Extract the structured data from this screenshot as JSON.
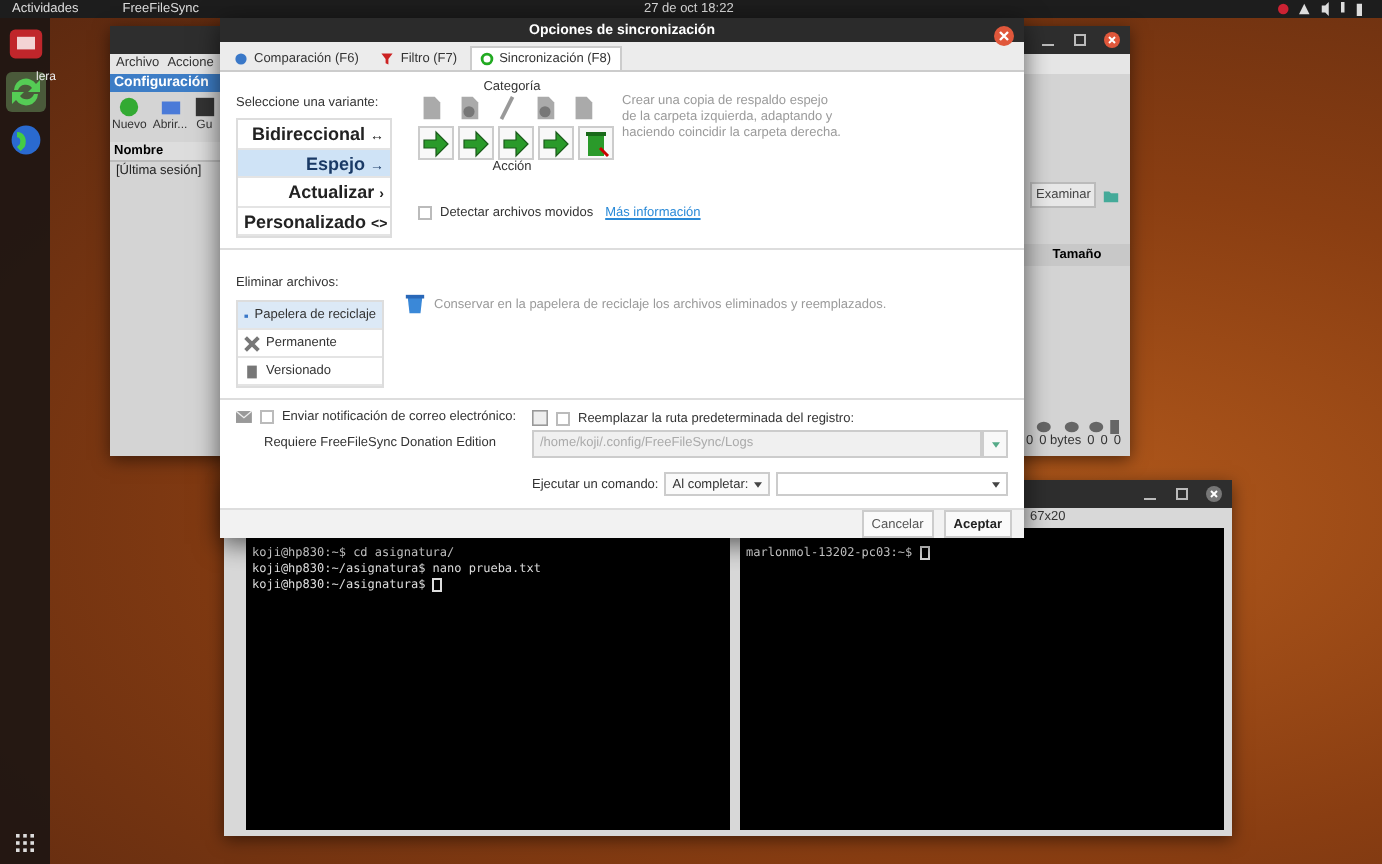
{
  "top_bar": {
    "activities": "Actividades",
    "app_menu": "FreeFileSync",
    "clock": "27 de oct  18:22"
  },
  "dock": {
    "label": "lera"
  },
  "main_window": {
    "menu": [
      "Archivo",
      "Accione"
    ],
    "panel_title": "Configuración",
    "toolbar": [
      "Nuevo",
      "Abrir...",
      "Gu"
    ],
    "column": "Nombre",
    "session": "[Última sesión]",
    "browse_button": "Examinar",
    "size_column": "Tamaño",
    "status": [
      "0",
      "0 bytes",
      "0",
      "0",
      "0"
    ]
  },
  "terminal": {
    "title": "67x20",
    "left_lines": [
      "koji@hp830:~$ cd asignatura/",
      "koji@hp830:~/asignatura$ nano prueba.txt",
      "koji@hp830:~/asignatura$ "
    ],
    "right_lines": [
      "marlonmol-13202-pc03:~$ "
    ]
  },
  "dialog": {
    "title": "Opciones de sincronización",
    "tabs": [
      {
        "label": "Comparación (F6)",
        "selected": false
      },
      {
        "label": "Filtro (F7)",
        "selected": false
      },
      {
        "label": "Sincronización (F8)",
        "selected": true
      }
    ],
    "variant_prompt": "Seleccione una variante:",
    "variants": [
      {
        "label": "Bidireccional",
        "symbol": "↔",
        "selected": false
      },
      {
        "label": "Espejo",
        "symbol": "→",
        "selected": true
      },
      {
        "label": "Actualizar",
        "symbol": "›",
        "selected": false
      },
      {
        "label": "Personalizado",
        "symbol": "<>",
        "selected": false
      }
    ],
    "category_label": "Categoría",
    "action_label": "Acción",
    "description": "Crear una copia de respaldo espejo de la carpeta izquierda, adaptando y haciendo coincidir la carpeta derecha.",
    "detect_moved": {
      "label": "Detectar archivos movidos",
      "checked": false
    },
    "more_info": "Más información",
    "delete_label": "Eliminar archivos:",
    "delete_options": [
      {
        "label": "Papelera de reciclaje",
        "selected": true
      },
      {
        "label": "Permanente",
        "selected": false
      },
      {
        "label": "Versionado",
        "selected": false
      }
    ],
    "delete_description": "Conservar en la papelera de reciclaje los archivos eliminados y reemplazados.",
    "email": {
      "label": "Enviar notificación de correo electrónico:",
      "checked": false,
      "note": "Requiere FreeFileSync Donation Edition"
    },
    "log": {
      "label": "Reemplazar la ruta predeterminada del registro:",
      "checked": false,
      "path": "/home/koji/.config/FreeFileSync/Logs"
    },
    "command": {
      "label": "Ejecutar un comando:",
      "when": "Al completar:"
    },
    "buttons": [
      {
        "label": "Cancelar",
        "kind": "secondary"
      },
      {
        "label": "Aceptar",
        "kind": "primary"
      }
    ]
  }
}
